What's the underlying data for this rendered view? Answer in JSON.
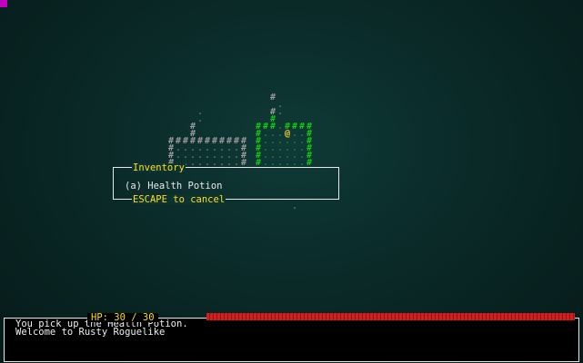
{
  "colors": {
    "background": "#0a2a28",
    "wall_seen": "#9a9a9a",
    "wall_visible": "#12c912",
    "player": "#ffd21a",
    "ui_title": "#ffdd1a",
    "ui_border": "#e8e8e8",
    "hp_bar": "#c81a1a"
  },
  "glyphs": {
    "wall": "#",
    "floor": ".",
    "player": "@"
  },
  "inventory": {
    "title": "Inventory",
    "items": [
      {
        "key": "(a)",
        "name": "Health Potion",
        "text": "(a) Health Potion"
      }
    ],
    "footer": "ESCAPE to cancel"
  },
  "status": {
    "hp_label": "HP: 30 / 30",
    "hp_current": 30,
    "hp_max": 30,
    "hp_fraction": 1.0
  },
  "log": {
    "lines": [
      "You pick up the Health Potion.",
      "Welcome to Rusty Roguelike"
    ]
  }
}
